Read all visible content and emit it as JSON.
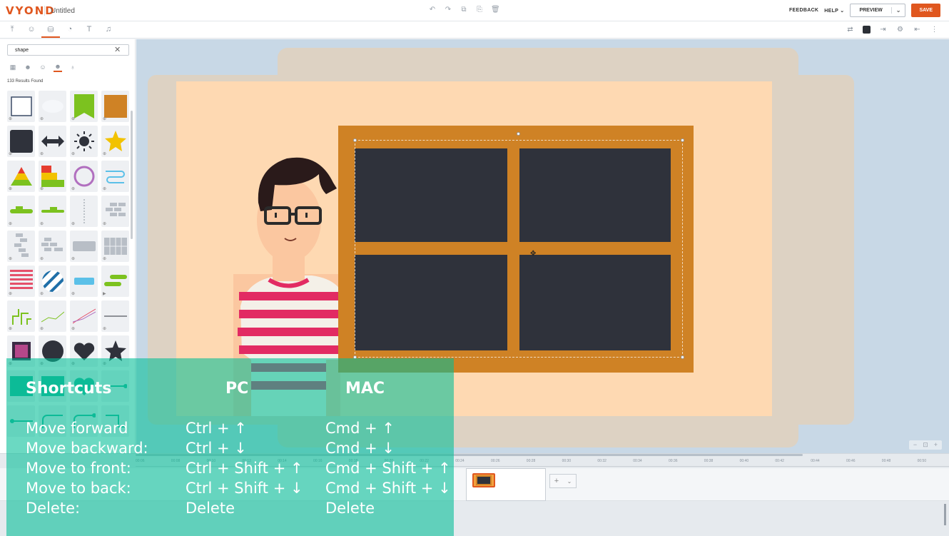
{
  "app": {
    "logo": "VYOND",
    "doc_title": "Untitled"
  },
  "topbar": {
    "feedback": "FEEDBACK",
    "help": "HELP",
    "help_caret": "⌄",
    "preview": "PREVIEW",
    "preview_caret": "⌄",
    "save": "SAVE"
  },
  "panel": {
    "search_value": "shape",
    "results": "133 Results Found"
  },
  "timeline": {
    "ticks": [
      "00:06",
      "00:08",
      "00:10",
      "00:12",
      "00:14",
      "00:16",
      "00:18",
      "00:20",
      "00:22",
      "00:24",
      "00:26",
      "00:28",
      "00:30",
      "00:32",
      "00:34",
      "00:36",
      "00:38",
      "00:40",
      "00:42",
      "00:44",
      "00:46",
      "00:48",
      "00:50"
    ]
  },
  "shortcuts": {
    "title": "Shortcuts",
    "pc_header": "PC",
    "mac_header": "MAC",
    "rows": [
      {
        "action": "Move forward",
        "pc": "Ctrl + ↑",
        "mac": "Cmd + ↑"
      },
      {
        "action": "Move backward:",
        "pc": "Ctrl + ↓",
        "mac": "Cmd + ↓"
      },
      {
        "action": "Move to front:",
        "pc": "Ctrl + Shift + ↑",
        "mac": "Cmd + Shift + ↑"
      },
      {
        "action": "Move to back:",
        "pc": "Ctrl + Shift + ↓",
        "mac": "Cmd + Shift + ↓"
      },
      {
        "action": "Delete:",
        "pc": "Delete",
        "mac": "Delete"
      }
    ]
  },
  "colors": {
    "accent": "#e0571f",
    "window_frame": "#cf8225",
    "window_pane": "#2f323b",
    "scene_bg": "#fed9b2",
    "overlay": "#00be96"
  }
}
